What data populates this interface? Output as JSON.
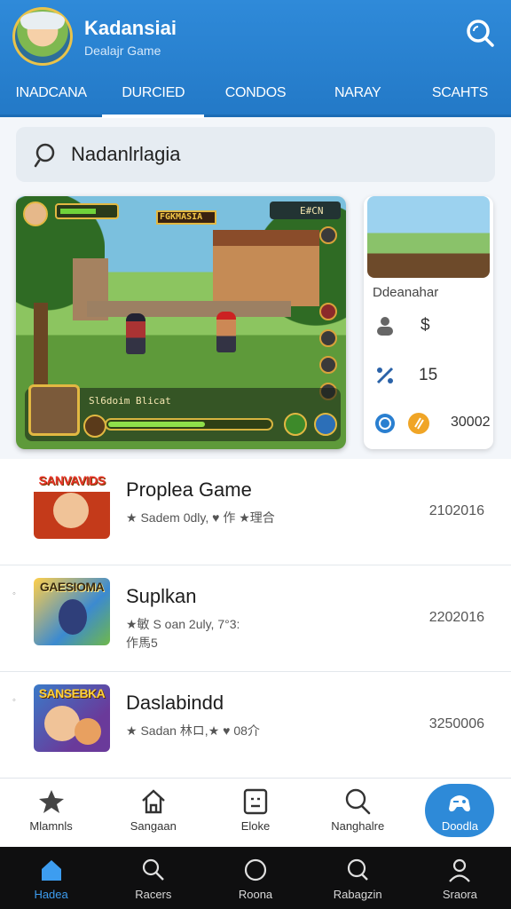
{
  "header": {
    "title": "Kadansiai",
    "subtitle": "Dealajr Game"
  },
  "tabs": [
    {
      "label": "INADCANA"
    },
    {
      "label": "DURCIED",
      "active": true
    },
    {
      "label": "CONDOS"
    },
    {
      "label": "NARAY"
    },
    {
      "label": "SCAHTS"
    }
  ],
  "search": {
    "value": "Nadanlrlagia",
    "placeholder": ""
  },
  "featured": {
    "hud_banner": "FGKMASIA",
    "hud_label": "Sl6doim Blicat",
    "hud_score": "E#CN",
    "hp_fraction": 0.62,
    "stamina_fraction": 0.6
  },
  "side_card": {
    "title": "Ddeanahar",
    "row1_value": "$",
    "row2_value": "15",
    "row3_value": "30002"
  },
  "games": [
    {
      "name": "Proplea Game",
      "logo_text": "SANVAVIDS",
      "meta_line1": "★ Sadem 0dly, ♥ 作 ★理合",
      "meta_line2": "",
      "count": "2102016"
    },
    {
      "name": "Suplkan",
      "logo_text": "GAESIOMA",
      "meta_line1": "★敏 S oan 2uly, 7°3:",
      "meta_line2": "作馬5",
      "count": "2202016"
    },
    {
      "name": "Daslabindd",
      "logo_text": "SANSEBKA",
      "meta_line1": "★ Sadan 林ロ,★ ♥ 08介",
      "meta_line2": "",
      "count": "3250006"
    }
  ],
  "bottom_actions": [
    {
      "label": "Mlamnls",
      "icon": "star-icon"
    },
    {
      "label": "Sangaan",
      "icon": "home-icon"
    },
    {
      "label": "Eloke",
      "icon": "square-face-icon"
    },
    {
      "label": "Nanghalre",
      "icon": "search-icon"
    },
    {
      "label": "Doodla",
      "icon": "gamepad-icon",
      "primary": true
    }
  ],
  "navbar": [
    {
      "label": "Hadea",
      "icon": "home-icon",
      "active": true
    },
    {
      "label": "Racers",
      "icon": "search-icon"
    },
    {
      "label": "Roona",
      "icon": "circle-icon"
    },
    {
      "label": "Rabagzin",
      "icon": "chat-icon"
    },
    {
      "label": "Sraora",
      "icon": "user-icon"
    }
  ],
  "colors": {
    "header": "#2f8ad9",
    "accent": "#3d9df0",
    "navbar": "#0f0f10"
  }
}
